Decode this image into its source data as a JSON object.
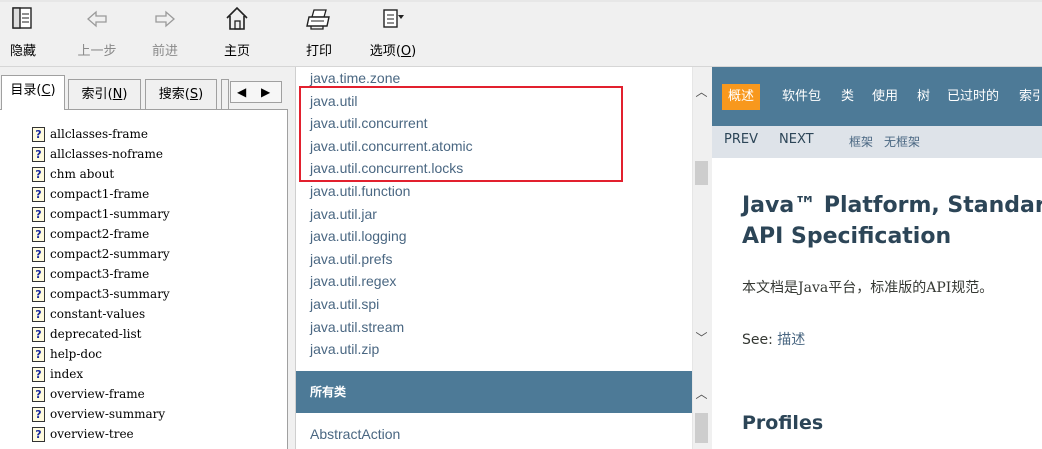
{
  "toolbar": {
    "hide": "隐藏",
    "back": "上一步",
    "forward": "前进",
    "home": "主页",
    "print": "打印",
    "options": "选项",
    "options_key": "O"
  },
  "left": {
    "tabs": {
      "contents": "目录",
      "contents_key": "C",
      "index": "索引",
      "index_key": "N",
      "search": "搜索",
      "search_key": "S"
    },
    "files": [
      "allclasses-frame",
      "allclasses-noframe",
      "chm about",
      "compact1-frame",
      "compact1-summary",
      "compact2-frame",
      "compact2-summary",
      "compact3-frame",
      "compact3-summary",
      "constant-values",
      "deprecated-list",
      "help-doc",
      "index",
      "overview-frame",
      "overview-summary",
      "overview-tree"
    ]
  },
  "middle": {
    "packages": [
      "java.time.zone",
      "java.util",
      "java.util.concurrent",
      "java.util.concurrent.atomic",
      "java.util.concurrent.locks",
      "java.util.function",
      "java.util.jar",
      "java.util.logging",
      "java.util.prefs",
      "java.util.regex",
      "java.util.spi",
      "java.util.stream",
      "java.util.zip"
    ],
    "all_classes_header": "所有类",
    "classes": [
      "AbstractAction"
    ]
  },
  "right": {
    "nav": {
      "overview": "概述",
      "items": [
        "软件包",
        "类",
        "使用",
        "树",
        "已过时的",
        "索引"
      ]
    },
    "subnav": {
      "prev": "PREV",
      "next": "NEXT",
      "frames": "框架",
      "no_frames": "无框架"
    },
    "title_line1": "Java™ Platform, Standard",
    "title_line2": "API Specification",
    "description": "本文档是Java平台，标准版的API规范。",
    "see_label": "See: ",
    "see_link": "描述",
    "profiles": "Profiles"
  },
  "colors": {
    "nav_bg": "#4d7a97",
    "nav_active": "#f8981d",
    "highlight_box": "#e2202e",
    "link": "#4a6782"
  }
}
